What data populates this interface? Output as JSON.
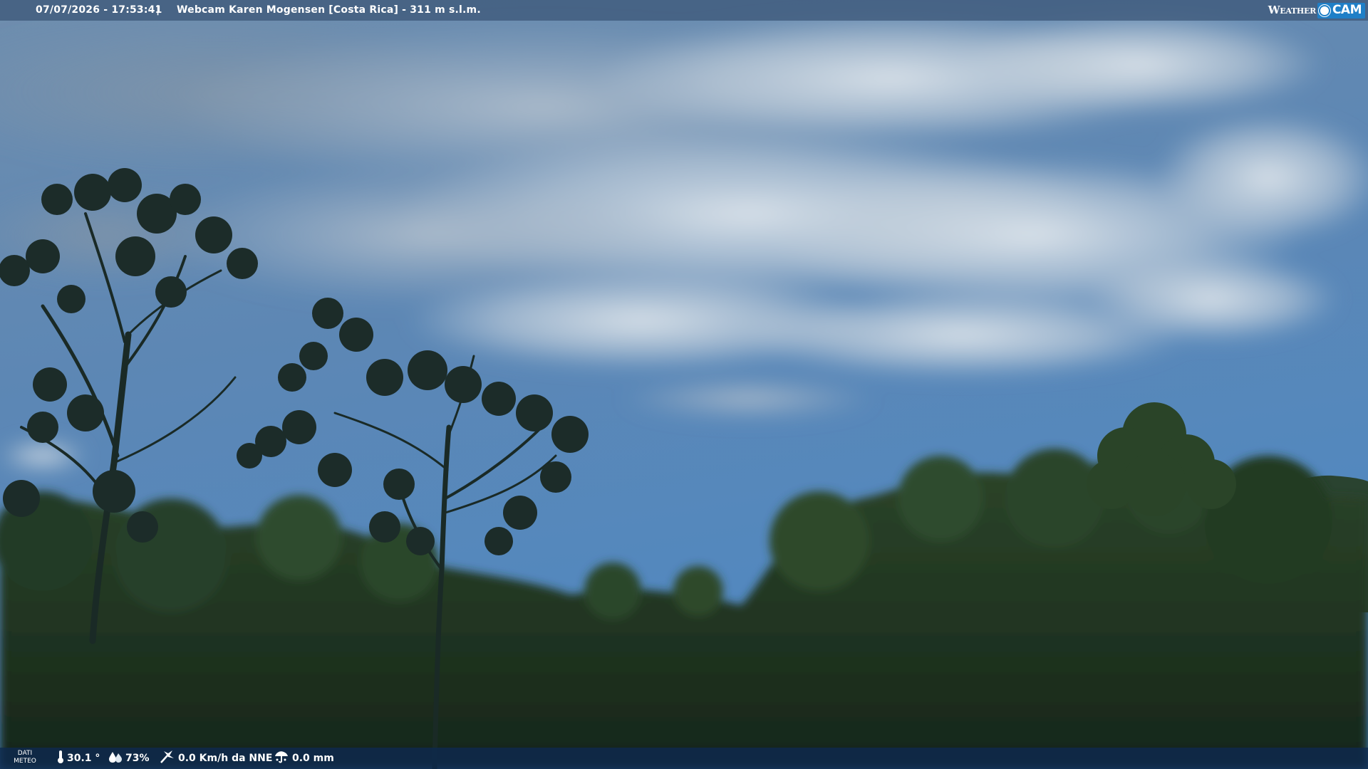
{
  "top_bar": {
    "datetime": "07/07/2026 - 17:53:41",
    "separator": "|",
    "camera_title": "Webcam Karen Mogensen [Costa Rica] - 311 m s.l.m.",
    "brand_weather": "Weather",
    "brand_cam": "CAM"
  },
  "bottom_bar": {
    "dati_label_line1": "DATI",
    "dati_label_line2": "METEO",
    "temperature": "30.1 °",
    "humidity": "73%",
    "wind": "0.0 Km/h da NNE",
    "rain": "0.0 mm",
    "icons": [
      "thermometer-icon",
      "humidity-icon",
      "wind-icon",
      "rain-icon"
    ]
  },
  "colors": {
    "sky_top": "#6d8dad",
    "sky_bottom": "#4f86be",
    "forest_dark": "#1e3320",
    "forest_mid": "#2e4a2c",
    "bar_top": "#3e587a",
    "bar_bottom": "#0e2a4e",
    "brand_blue": "#1f7fc7"
  }
}
